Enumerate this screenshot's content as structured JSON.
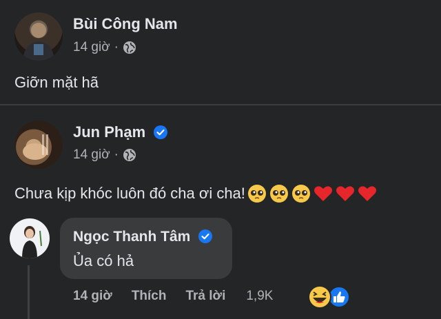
{
  "post": {
    "author": "Bùi Công Nam",
    "time": "14 giờ",
    "separator": "·",
    "privacy_icon": "globe-icon",
    "text": "Giỡn mặt hã"
  },
  "comment": {
    "author": "Jun Phạm",
    "verified": true,
    "time": "14 giờ",
    "separator": "·",
    "privacy_icon": "globe-icon",
    "text": "Chưa kịp khóc luôn đó cha ơi cha!",
    "emojis": [
      "pleading-face",
      "pleading-face",
      "pleading-face",
      "red-heart",
      "red-heart",
      "red-heart"
    ]
  },
  "reply": {
    "author": "Ngọc Thanh Tâm",
    "verified": true,
    "text": "Ủa có hả",
    "time": "14 giờ",
    "like_label": "Thích",
    "reply_label": "Trả lời",
    "reaction_count": "1,9K",
    "reaction_icons": [
      "haha-icon",
      "like-icon"
    ]
  },
  "colors": {
    "background": "#242526",
    "bubble": "#3a3b3c",
    "primary_text": "#e4e6eb",
    "secondary_text": "#b0b3b8",
    "verified_blue": "#1877f2"
  }
}
